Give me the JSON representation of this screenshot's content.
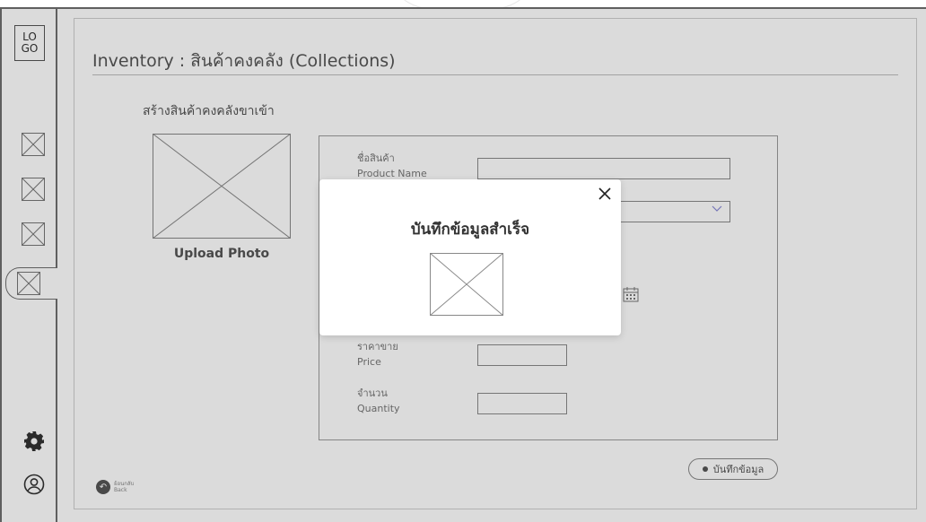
{
  "sidebar": {
    "logo_text": "LO\nGO",
    "items": [
      {
        "icon": "placeholder-image-icon"
      },
      {
        "icon": "placeholder-image-icon"
      },
      {
        "icon": "placeholder-image-icon"
      },
      {
        "icon": "placeholder-image-icon",
        "active": true
      }
    ],
    "bottom": [
      {
        "icon": "settings-icon"
      },
      {
        "icon": "profile-icon"
      }
    ]
  },
  "page": {
    "title": "Inventory : สินค้าคงคลัง (Collections)",
    "section_title": "สร้างสินค้าคงคลังขาเข้า",
    "upload_label": "Upload Photo"
  },
  "form": {
    "fields": [
      {
        "label": "ชื่อสินค้า\nProduct Name",
        "value": ""
      },
      {
        "label": "ราคาขาย\nPrice",
        "value": ""
      },
      {
        "label": "จำนวน\nQuantity",
        "value": ""
      }
    ],
    "save_button": "บันทึกข้อมูล"
  },
  "back": {
    "label": "ย้อนกลับ\nBack"
  },
  "modal": {
    "title": "บันทึกข้อมูลสำเร็จ"
  },
  "colors": {
    "frame_border": "#6f6f6f",
    "overlay": "rgba(0,0,0,0.14)",
    "chevron": "#7a7aff"
  }
}
